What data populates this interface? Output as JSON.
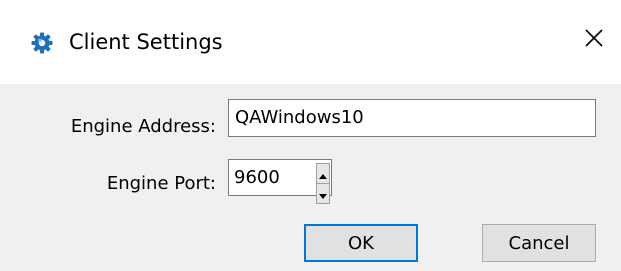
{
  "window": {
    "title": "Client Settings"
  },
  "icons": {
    "app": "gear-icon",
    "close": "close-icon",
    "spin_up": "triangle-up-icon",
    "spin_down": "triangle-down-icon"
  },
  "form": {
    "engine_address": {
      "label": "Engine Address:",
      "value": "QAWindows10"
    },
    "engine_port": {
      "label": "Engine Port:",
      "value": "9600"
    }
  },
  "buttons": {
    "ok": "OK",
    "cancel": "Cancel"
  },
  "colors": {
    "focus_accent": "#0078d7",
    "client_bg": "#f0f0f0",
    "icon_blue": "#1d6fb8"
  }
}
